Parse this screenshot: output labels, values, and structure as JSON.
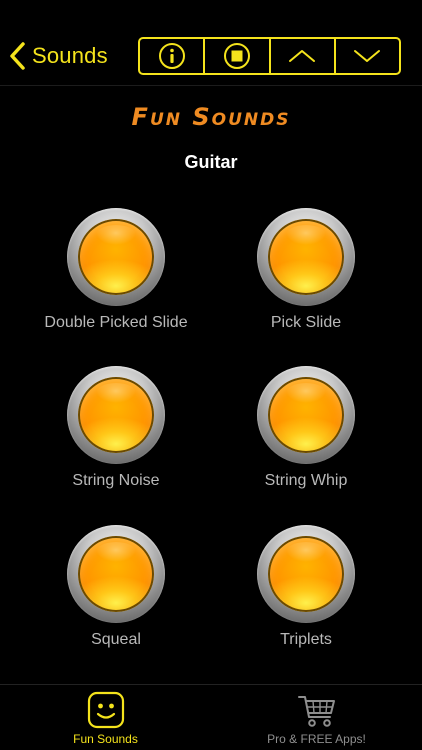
{
  "colors": {
    "accent": "#f4e31c",
    "title": "#ef8b22",
    "label": "#b9b9b9",
    "inactive": "#8f8f8f"
  },
  "navbar": {
    "back_label": "Sounds",
    "buttons": [
      {
        "name": "info",
        "icon": "info-icon"
      },
      {
        "name": "stop",
        "icon": "stop-icon"
      },
      {
        "name": "previous",
        "icon": "chevron-up-icon"
      },
      {
        "name": "next",
        "icon": "chevron-down-icon"
      }
    ]
  },
  "header": {
    "title": "Fun Sounds",
    "category": "Guitar"
  },
  "sounds": [
    {
      "label": "Double Picked Slide"
    },
    {
      "label": "Pick Slide"
    },
    {
      "label": "String Noise"
    },
    {
      "label": "String Whip"
    },
    {
      "label": "Squeal"
    },
    {
      "label": "Triplets"
    }
  ],
  "tabbar": {
    "tabs": [
      {
        "label": "Fun Sounds",
        "icon": "smiley-icon",
        "active": true
      },
      {
        "label": "Pro & FREE Apps!",
        "icon": "cart-icon",
        "active": false
      }
    ]
  }
}
